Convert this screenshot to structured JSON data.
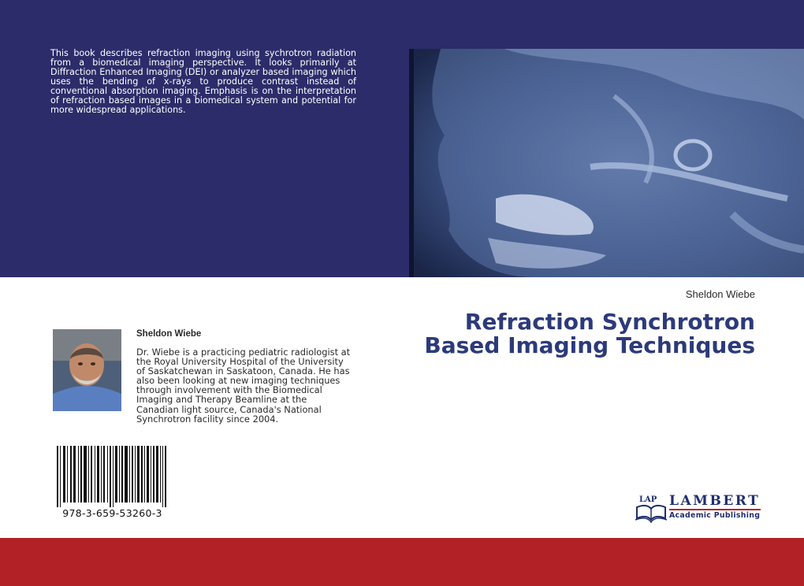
{
  "back_cover": {
    "blurb": "This book describes refraction imaging using sychrotron radiation from a biomedical imaging perspective. It looks primarily at Diffraction Enhanced Imaging (DEI) or analyzer based imaging which uses the bending of x-rays to produce contrast instead of conventional absorption imaging. Emphasis is on the interpretation of refraction based images in a biomedical system and potential for more widespread applications.",
    "author_name": "Sheldon Wiebe",
    "author_bio": "Dr. Wiebe is a practicing pediatric radiologist at the Royal University Hospital of the University of Saskatchewan in Saskatoon, Canada. He has also been looking at new imaging techniques through involvement with the Biomedical Imaging and Therapy Beamline at the Canadian light source, Canada's National Synchrotron facility since 2004.",
    "isbn": "978-3-659-53260-3"
  },
  "front_cover": {
    "author": "Sheldon Wiebe",
    "title_line1": "Refraction Synchrotron",
    "title_line2": "Based Imaging Techniques",
    "image": "skull-xray-lateral"
  },
  "publisher": {
    "logo_mark": "LAP",
    "name": "LAMBERT",
    "subtitle": "Academic Publishing"
  },
  "colors": {
    "top_band": "#2c2c6a",
    "title": "#2c3a7a",
    "bottom_band": "#b22126",
    "publisher_blue": "#1f2f6e"
  }
}
